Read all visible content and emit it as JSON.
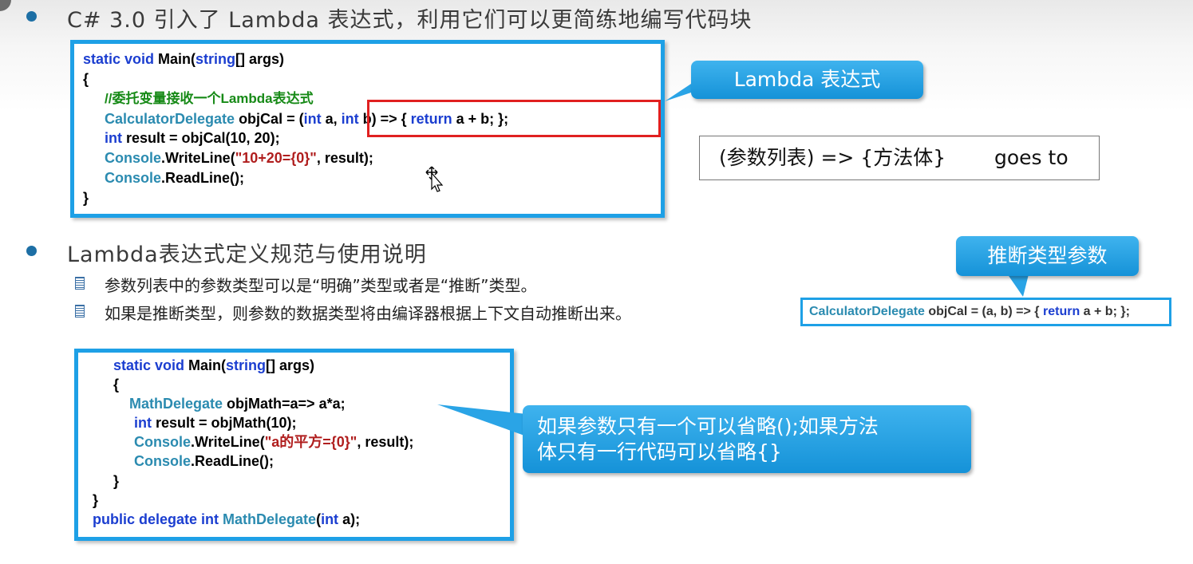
{
  "section1": {
    "heading": "C# 3.0 引入了 Lambda 表达式，利用它们可以更简练地编写代码块"
  },
  "code1": {
    "l1a": "static void",
    "l1b": " Main(",
    "l1c": "string",
    "l1d": "[] args)",
    "l2": "{",
    "l3": "//委托变量接收一个Lambda表达式",
    "l4a": "CalculatorDelegate",
    "l4b": " objCal = ",
    "l4c": "(",
    "l4d": "int",
    "l4e": " a, ",
    "l4f": "int",
    "l4g": " b) => { ",
    "l4h": "return",
    "l4i": " a + b; };",
    "l5a": "int",
    "l5b": " result = objCal(10, 20);",
    "l6a": "Console",
    "l6b": ".WriteLine(",
    "l6c": "\"10+20={0}\"",
    "l6d": ", result);",
    "l7a": "Console",
    "l7b": ".ReadLine();",
    "l8": "}"
  },
  "callout_lambda": "Lambda 表达式",
  "note_syntax": {
    "text": "(参数列表) => {方法体}",
    "goes": "goes to"
  },
  "section2": {
    "heading": "Lambda表达式定义规范与使用说明",
    "items": [
      "参数列表中的参数类型可以是“明确”类型或者是“推断”类型。",
      "如果是推断类型，则参数的数据类型将由编译器根据上下文自动推断出来。"
    ]
  },
  "callout_infer": "推断类型参数",
  "mini_code": {
    "a": "CalculatorDelegate",
    "b": " objCal = (a, b) => { ",
    "c": "return",
    "d": " a + b; };"
  },
  "code2": {
    "l1a": "static void",
    "l1b": " Main(",
    "l1c": "string",
    "l1d": "[] args)",
    "l2": "{",
    "l3a": "MathDelegate",
    "l3b": " objMath=a=> a*a;",
    "l4a": "int",
    "l4b": " result = objMath(10);",
    "l5a": "Console",
    "l5b": ".WriteLine(",
    "l5c": "\"a的平方={0}\"",
    "l5d": ", result);",
    "l6a": "Console",
    "l6b": ".ReadLine();",
    "l7": "}",
    "l8": "}",
    "l9a": "public delegate int",
    "l9b": " MathDelegate",
    "l9c": "(",
    "l9d": "int",
    "l9e": " a);"
  },
  "callout_omit": {
    "line1": "如果参数只有一个可以省略();如果方法",
    "line2": "体只有一行代码可以省略{}"
  },
  "colors": {
    "accent": "#1ea0e6",
    "keyword": "#1b3ed0",
    "type": "#2b8bb0",
    "comment": "#178a17",
    "string": "#b01e1e",
    "highlight": "#e02020"
  }
}
